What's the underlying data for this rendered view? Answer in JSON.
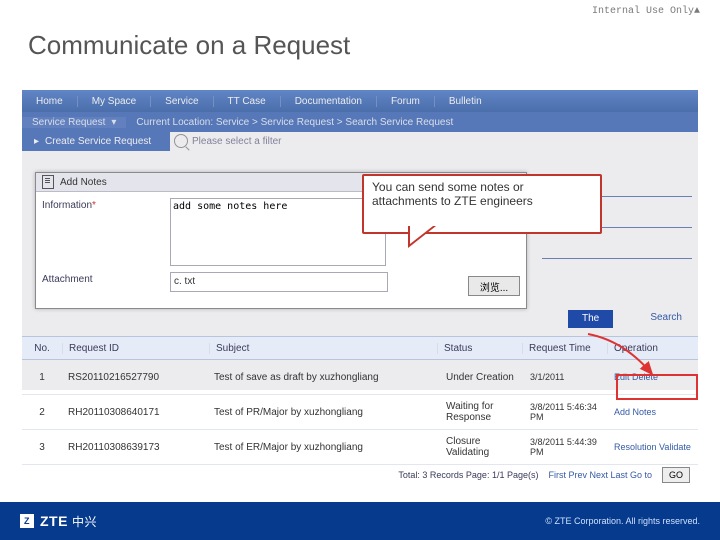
{
  "classification": "Internal Use Only▲",
  "slide_title": "Communicate on a Request",
  "nav": {
    "items": [
      "Home",
      "My Space",
      "Service",
      "TT Case",
      "Documentation",
      "Forum",
      "Bulletin"
    ]
  },
  "subbar": {
    "tab": "Service Request",
    "breadcrumb": "Current Location: Service > Service Request > Search Service Request"
  },
  "side": {
    "create": "Create Service Request"
  },
  "filter": {
    "placeholder": "Please select a filter"
  },
  "modal": {
    "title": "Add Notes",
    "info_label": "Information",
    "notes_value": "add some notes here",
    "attach_label": "Attachment",
    "file_value": "c. txt",
    "browse": "浏览..."
  },
  "callout": "You can send some notes or attachments to ZTE engineers",
  "rh_label_the": "The",
  "search_link": "Search",
  "table": {
    "headers": {
      "no": "No.",
      "rid": "Request ID",
      "subj": "Subject",
      "stat": "Status",
      "time": "Request Time",
      "op": "Operation"
    },
    "rows": [
      {
        "no": "1",
        "rid": "RS20110216527790",
        "subj": "Test of save as draft by xuzhongliang",
        "stat": "Under Creation",
        "time": "3/1/2011",
        "op": "Edit Delete"
      },
      {
        "no": "2",
        "rid": "RH20110308640171",
        "subj": "Test of PR/Major by xuzhongliang",
        "stat": "Waiting for Response",
        "time": "3/8/2011 5:46:34 PM",
        "op": "Add Notes"
      },
      {
        "no": "3",
        "rid": "RH20110308639173",
        "subj": "Test of ER/Major by xuzhongliang",
        "stat": "Closure Validating",
        "time": "3/8/2011 5:44:39 PM",
        "op": "Resolution Validate"
      }
    ],
    "pager_total": "Total: 3 Records Page: 1/1 Page(s)",
    "pager_links": "First Prev Next Last Go to",
    "go": "GO"
  },
  "footer": {
    "logo": "ZTE",
    "logo_cn": "中兴",
    "copy": "© ZTE Corporation. All rights reserved."
  }
}
